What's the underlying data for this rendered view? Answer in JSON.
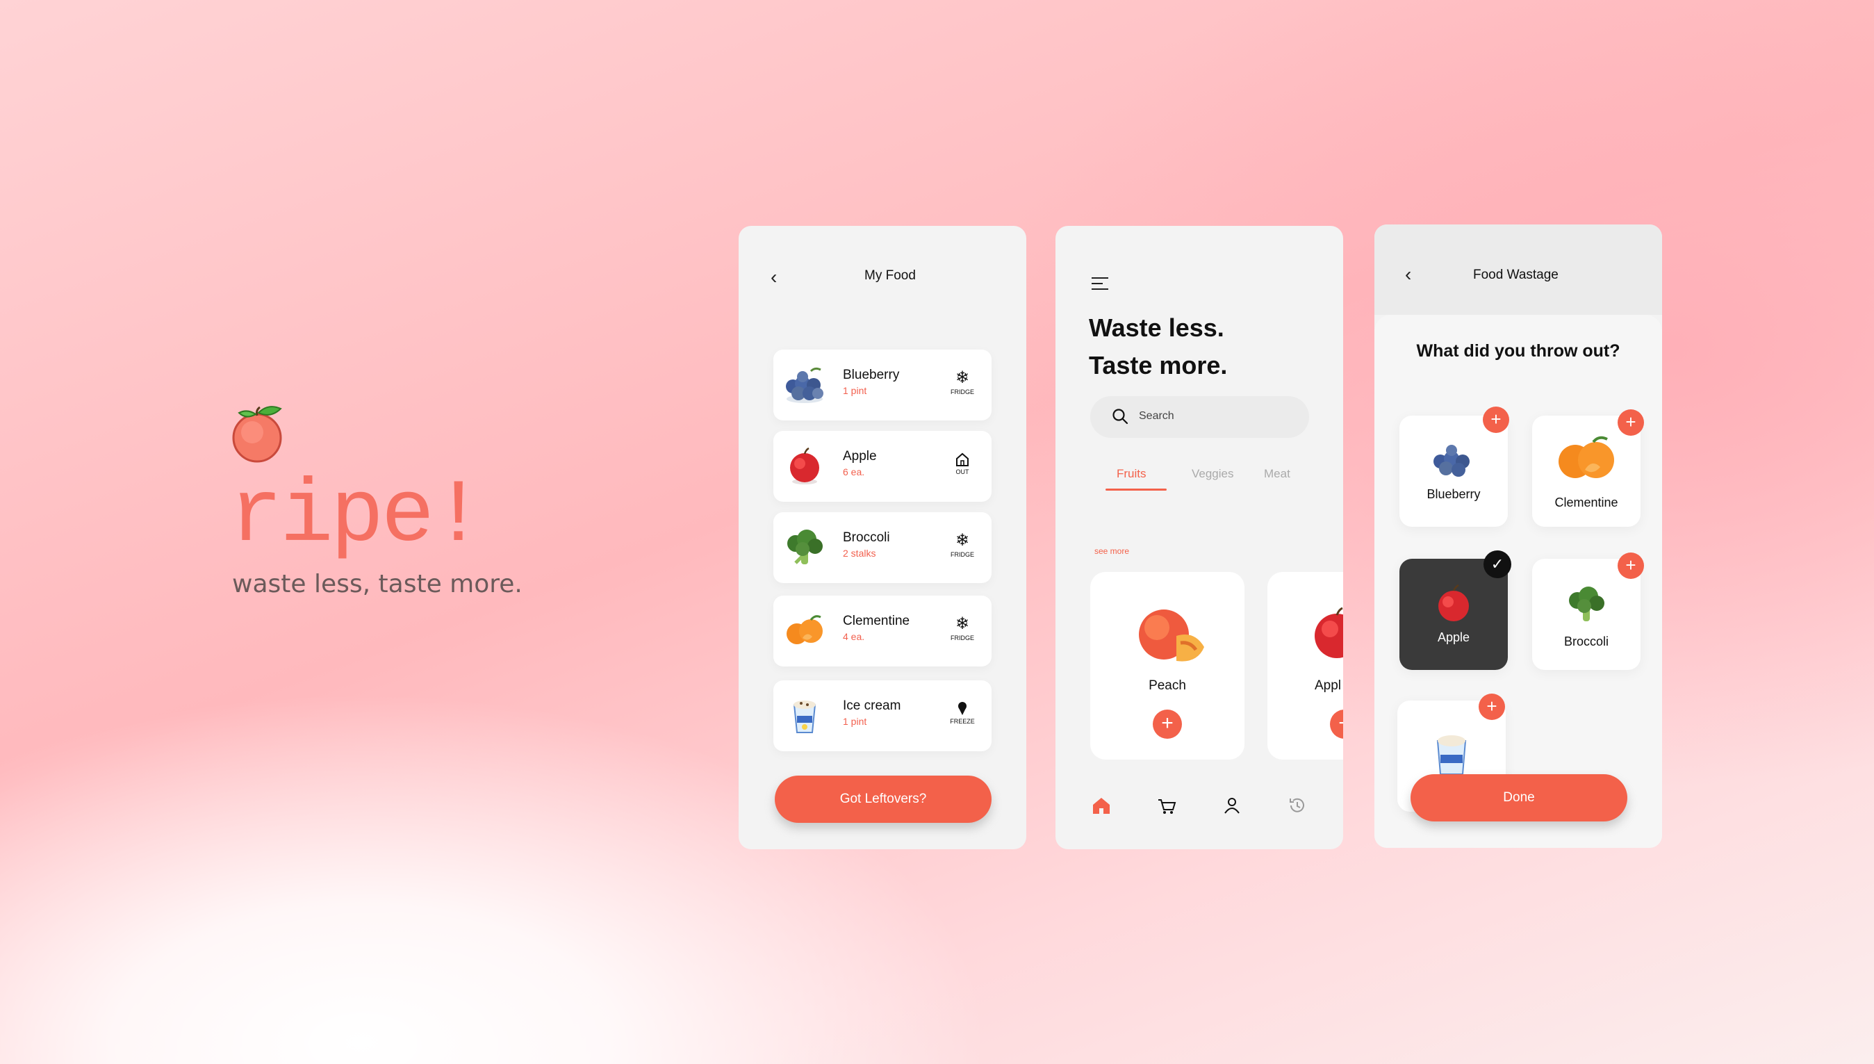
{
  "brand": {
    "name": "ripe!",
    "tagline": "waste less, taste more."
  },
  "my_food": {
    "title": "My Food",
    "items": [
      {
        "name": "Blueberry",
        "qty": "1 pint",
        "location": "FRIDGE",
        "location_icon": "snowflake-icon"
      },
      {
        "name": "Apple",
        "qty": "6 ea.",
        "location": "OUT",
        "location_icon": "house-icon"
      },
      {
        "name": "Broccoli",
        "qty": "2 stalks",
        "location": "FRIDGE",
        "location_icon": "snowflake-icon"
      },
      {
        "name": "Clementine",
        "qty": "4 ea.",
        "location": "FRIDGE",
        "location_icon": "snowflake-icon"
      },
      {
        "name": "Ice cream",
        "qty": "1 pint",
        "location": "FREEZE",
        "location_icon": "ice-cream-icon"
      }
    ],
    "cta": "Got Leftovers?"
  },
  "home": {
    "headline_1": "Waste less.",
    "headline_2": "Taste more.",
    "search_placeholder": "Search",
    "tabs": [
      {
        "label": "Fruits",
        "active": true
      },
      {
        "label": "Veggies",
        "active": false
      },
      {
        "label": "Meat",
        "active": false
      }
    ],
    "see_more": "see more",
    "products": [
      {
        "name": "Peach"
      },
      {
        "name": "Appl"
      }
    ],
    "nav": [
      "home-icon",
      "cart-icon",
      "profile-icon",
      "history-icon"
    ]
  },
  "wastage": {
    "title": "Food Wastage",
    "question": "What did you throw out?",
    "tiles": [
      {
        "name": "Blueberry",
        "selected": false
      },
      {
        "name": "Clementine",
        "selected": false
      },
      {
        "name": "Apple",
        "selected": true
      },
      {
        "name": "Broccoli",
        "selected": false
      },
      {
        "name": "",
        "selected": false
      }
    ],
    "cta": "Done"
  },
  "colors": {
    "accent": "#f3614a",
    "brand": "#f57062",
    "selected_tile": "#3a3a3a"
  }
}
